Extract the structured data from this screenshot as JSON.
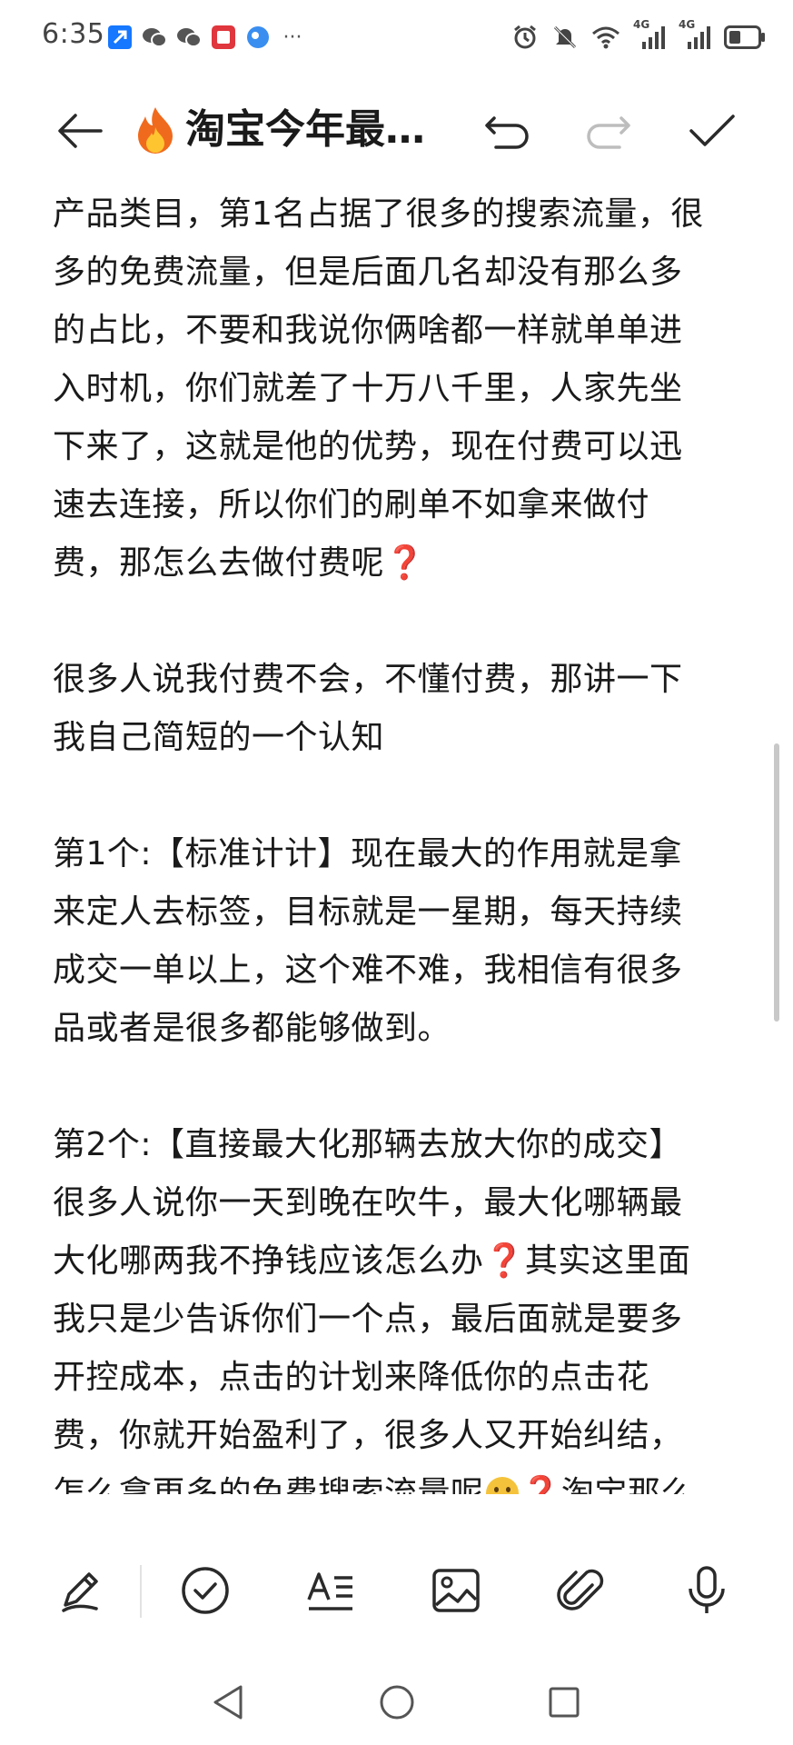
{
  "status": {
    "time": "6:35",
    "app_icons": [
      "navigation-app-icon",
      "wechat-icon",
      "wechat-icon",
      "red-app-icon",
      "blue-app-icon"
    ],
    "more": "···",
    "network_1": "4G",
    "network_2": "4G",
    "right_icons": [
      "alarm-icon",
      "mute-icon",
      "wifi-icon",
      "signal-icon",
      "signal-icon",
      "battery-icon"
    ]
  },
  "header": {
    "title": "淘宝今年最…",
    "title_emoji": "fire-icon"
  },
  "content": {
    "paragraphs": [
      [
        "产品类目，第1名占据了很多的搜索流量，很",
        "多的免费流量，但是后面几名却没有那么多",
        "的占比，不要和我说你俩啥都一样就单单进",
        "入时机，你们就差了十万八千里，人家先坐",
        "下来了，这就是他的优势，现在付费可以迅",
        "速去连接，所以你们的刷单不如拿来做付",
        "费，那怎么去做付费呢"
      ],
      [
        "很多人说我付费不会，不懂付费，那讲一下",
        "我自己简短的一个认知"
      ],
      [
        "第1个:【标准计计】现在最大的作用就是拿",
        "来定人去标签，目标就是一星期，每天持续",
        "成交一单以上，这个难不难，我相信有很多",
        "品或者是很多都能够做到。"
      ],
      [
        "第2个:【直接最大化那辆去放大你的成交】",
        "很多人说你一天到晚在吹牛，最大化哪辆最",
        "大化哪两我不挣钱应该怎么办",
        "其实这里面",
        "我只是少告诉你们一个点，最后面就是要多",
        "开控成本，点击的计划来降低你的点击花",
        "费，你就开始盈利了，很多人又开始纠结，",
        "怎么拿更多的免费搜索流量呢",
        "淘宝那么"
      ]
    ],
    "question_mark": "❓"
  },
  "toolbar": {
    "tools": [
      "pen-icon",
      "checkbox-icon",
      "text-format-icon",
      "image-icon",
      "attachment-icon",
      "microphone-icon"
    ]
  },
  "colors": {
    "text": "#1a1a1a",
    "question_mark": "#d9343b",
    "icon": "#2a2a2a",
    "disabled_icon": "#bdbdbd"
  }
}
